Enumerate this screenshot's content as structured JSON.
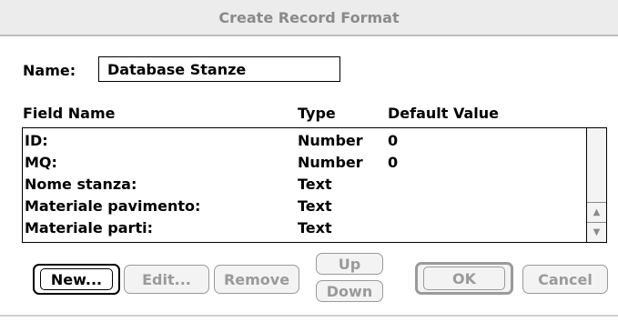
{
  "window": {
    "title": "Create Record Format"
  },
  "name_field": {
    "label": "Name:",
    "value": "Database Stanze"
  },
  "columns": {
    "field_name": "Field Name",
    "type": "Type",
    "default_value": "Default Value"
  },
  "fields": [
    {
      "name": "ID:",
      "type": "Number",
      "default": "0"
    },
    {
      "name": "MQ:",
      "type": "Number",
      "default": "0"
    },
    {
      "name": "Nome stanza:",
      "type": "Text",
      "default": ""
    },
    {
      "name": "Materiale pavimento:",
      "type": "Text",
      "default": ""
    },
    {
      "name": "Materiale parti:",
      "type": "Text",
      "default": ""
    }
  ],
  "buttons": {
    "new": "New...",
    "edit": "Edit...",
    "remove": "Remove",
    "up": "Up",
    "down": "Down",
    "ok": "OK",
    "cancel": "Cancel"
  },
  "scrollbar": {
    "up_icon": "triangle-up-icon",
    "down_icon": "triangle-down-icon"
  }
}
